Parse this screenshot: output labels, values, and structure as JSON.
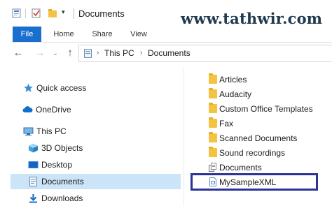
{
  "window": {
    "title": "Documents"
  },
  "watermark": "www.tathwir.com",
  "ribbon": {
    "tabs": [
      "File",
      "Home",
      "Share",
      "View"
    ]
  },
  "address": {
    "crumbs": [
      "This PC",
      "Documents"
    ]
  },
  "nav": {
    "items": [
      {
        "label": "Quick access",
        "icon": "star-icon"
      },
      {
        "label": "OneDrive",
        "icon": "cloud-icon"
      },
      {
        "label": "This PC",
        "icon": "computer-icon"
      },
      {
        "label": "3D Objects",
        "icon": "cube-icon"
      },
      {
        "label": "Desktop",
        "icon": "desktop-icon"
      },
      {
        "label": "Documents",
        "icon": "document-icon",
        "selected": true
      },
      {
        "label": "Downloads",
        "icon": "download-icon"
      }
    ]
  },
  "files": [
    {
      "label": "Articles",
      "type": "folder"
    },
    {
      "label": "Audacity",
      "type": "folder"
    },
    {
      "label": "Custom Office Templates",
      "type": "folder"
    },
    {
      "label": "Fax",
      "type": "folder"
    },
    {
      "label": "Scanned Documents",
      "type": "folder"
    },
    {
      "label": "Sound recordings",
      "type": "folder"
    },
    {
      "label": "Documents",
      "type": "library"
    },
    {
      "label": "MySampleXML",
      "type": "xml-file",
      "highlighted": true
    }
  ],
  "colors": {
    "accent": "#1a6fce",
    "selection": "#cce4f7",
    "highlight_border": "#2b3398",
    "folder": "#f5c342"
  }
}
